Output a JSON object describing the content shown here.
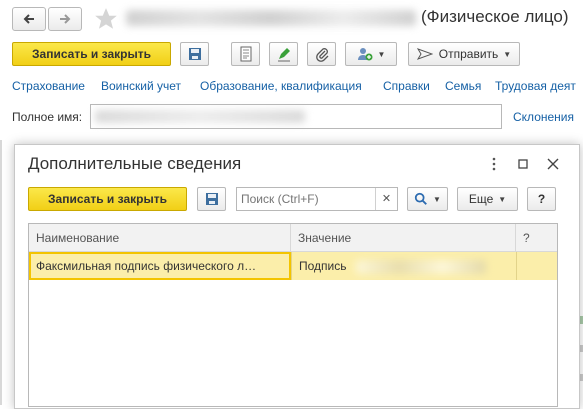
{
  "window": {
    "title_suffix": "(Физическое лицо)"
  },
  "toolbar": {
    "save_close_label": "Записать и закрыть",
    "send_label": "Отправить"
  },
  "links": [
    "Страхование",
    "Воинский учет",
    "Образование, квалификация",
    "Справки",
    "Семья",
    "Трудовая деят"
  ],
  "full_name": {
    "label": "Полное имя:",
    "declension_link": "Склонения"
  },
  "dialog": {
    "title": "Дополнительные сведения",
    "save_close_label": "Записать и закрыть",
    "search_placeholder": "Поиск (Ctrl+F)",
    "more_label": "Еще",
    "help_label": "?",
    "table": {
      "columns": [
        "Наименование",
        "Значение",
        "?"
      ],
      "rows": [
        {
          "name": "Факсмильная подпись физического л…",
          "value": "Подпись"
        }
      ]
    }
  },
  "colors": {
    "accent_yellow": "#f1cf16",
    "link_blue": "#1560a5",
    "row_highlight": "#fbeeaa"
  },
  "icons": [
    "arrow-left-icon",
    "arrow-right-icon",
    "star-icon",
    "save-icon",
    "document-icon",
    "edit-icon",
    "paperclip-icon",
    "users-icon",
    "send-icon",
    "kebab-icon",
    "maximize-icon",
    "close-icon",
    "search-icon",
    "clear-icon"
  ]
}
